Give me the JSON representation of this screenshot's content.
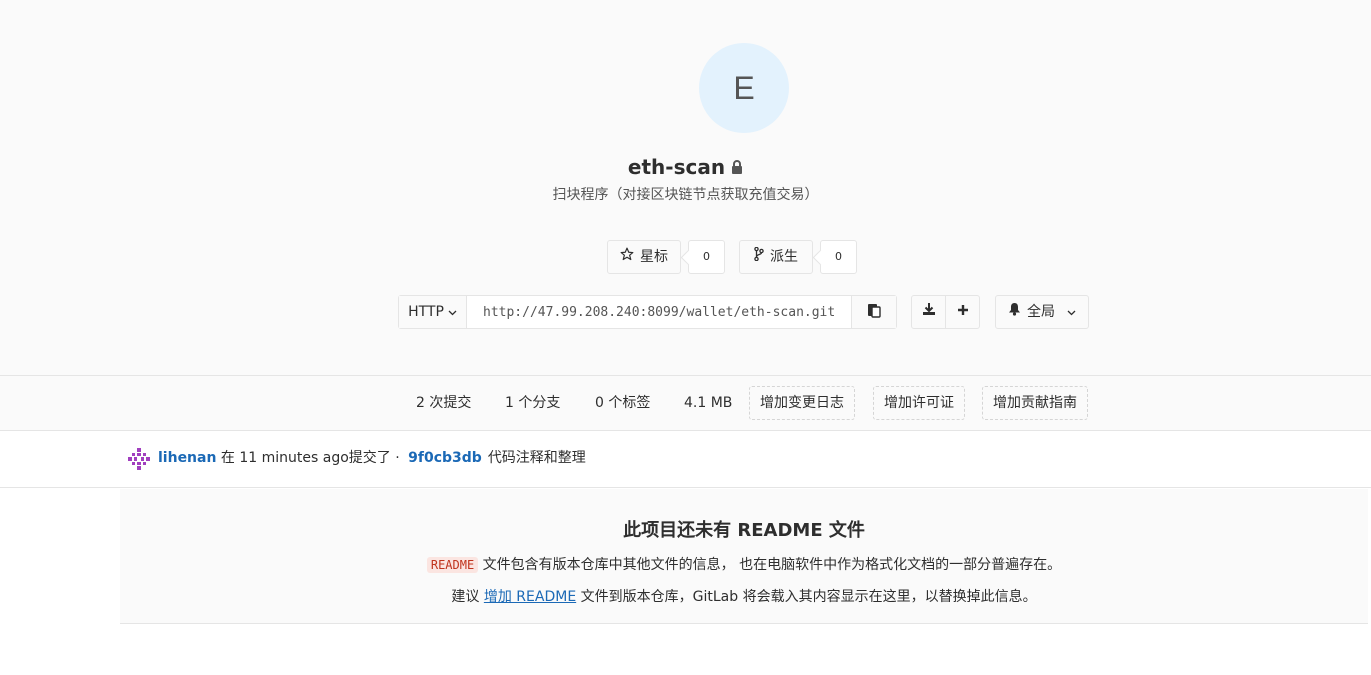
{
  "project": {
    "avatar_letter": "E",
    "name": "eth-scan",
    "description": "扫块程序（对接区块链节点获取充值交易）"
  },
  "actions": {
    "star_label": "星标",
    "star_count": "0",
    "fork_label": "派生",
    "fork_count": "0"
  },
  "clone": {
    "protocol": "HTTP",
    "url": "http://47.99.208.240:8099/wallet/eth-scan.git"
  },
  "notifications": {
    "level": "全局"
  },
  "stats": {
    "commits": "2 次提交",
    "branches": "1 个分支",
    "tags": "0 个标签",
    "size": "4.1 MB",
    "add_changelog": "增加变更日志",
    "add_license": "增加许可证",
    "add_contributing": "增加贡献指南"
  },
  "last_commit": {
    "author": "lihenan",
    "time_text": " 在 11 minutes ago提交了 · ",
    "sha": "9f0cb3db",
    "message": "代码注释和整理"
  },
  "readme": {
    "title": "此项目还未有 README 文件",
    "code_word": "README",
    "p1_text": " 文件包含有版本仓库中其他文件的信息， 也在电脑软件中作为格式化文档的一部分普遍存在。",
    "p2_prefix": "建议 ",
    "p2_link": "增加 README",
    "p2_suffix": " 文件到版本仓库，GitLab 将会载入其内容显示在这里，以替换掉此信息。"
  },
  "icons": {
    "star": "star-icon",
    "fork": "fork-icon",
    "lock": "lock-icon",
    "copy": "clipboard-icon",
    "download": "download-icon",
    "plus": "plus-icon",
    "bell": "bell-icon",
    "chevron": "chevron-down-icon"
  },
  "colors": {
    "link": "#1b69b6",
    "avatar_bg": "#e3f2fd",
    "code_fg": "#c0341d"
  }
}
